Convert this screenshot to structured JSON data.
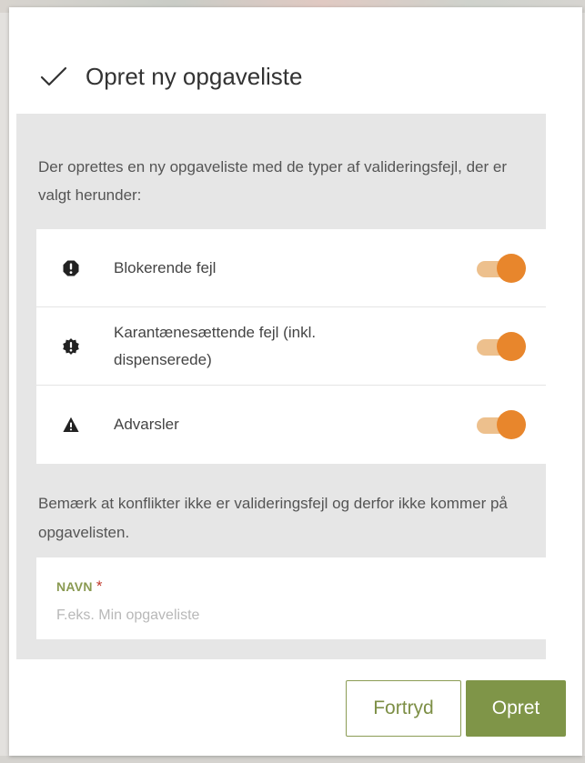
{
  "dialog": {
    "title": "Opret ny opgaveliste",
    "title_icon": "check-icon",
    "intro": "Der oprettes en ny opgaveliste med de typer af valideringsfejl, der er valgt herunder:",
    "toggles": [
      {
        "label": "Blokerende fejl",
        "icon": "exclamation-circle-icon",
        "enabled": true
      },
      {
        "label": "Karantænesættende fejl (inkl. dispenserede)",
        "icon": "exclamation-badge-icon",
        "enabled": true
      },
      {
        "label": "Advarsler",
        "icon": "warning-triangle-icon",
        "enabled": true
      }
    ],
    "note": "Bemærk at konflikter ikke er valideringsfejl og derfor ikke kommer på opgavelisten.",
    "name_field": {
      "label": "NAVN",
      "required_marker": "*",
      "value": "",
      "placeholder": "F.eks. Min opgaveliste"
    },
    "buttons": {
      "cancel_label": "Fortryd",
      "create_label": "Opret"
    }
  },
  "colors": {
    "accent_green": "#7f9548",
    "toggle_on": "#e8862c",
    "toggle_track": "#edc08d",
    "required": "#c0392b"
  }
}
